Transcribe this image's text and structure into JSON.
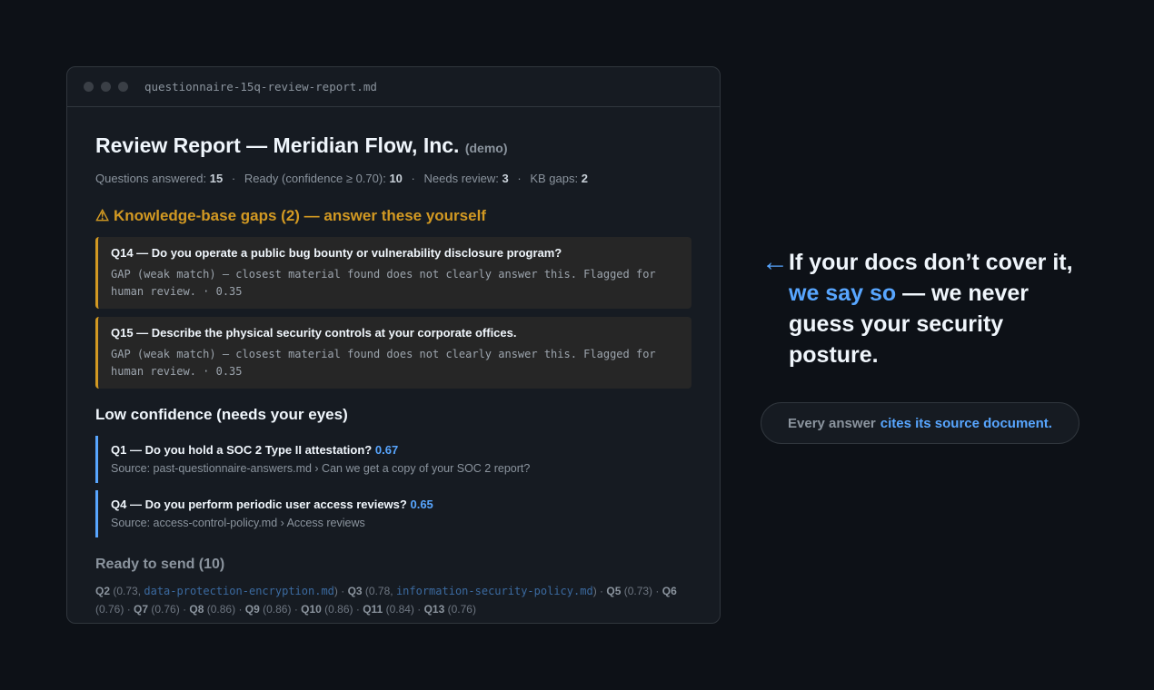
{
  "window": {
    "filename": "questionnaire-15q-review-report.md"
  },
  "report": {
    "title": "Review Report — Meridian Flow, Inc.",
    "demo_tag": "(demo)",
    "stats": {
      "answered_label": "Questions answered:",
      "answered_value": "15",
      "ready_label": "Ready (confidence ≥ 0.70):",
      "ready_value": "10",
      "review_label": "Needs review:",
      "review_value": "3",
      "gaps_label": "KB gaps:",
      "gaps_value": "2",
      "separator": "·"
    },
    "gaps_heading": "⚠ Knowledge-base gaps (2) — answer these yourself",
    "gaps": [
      {
        "question": "Q14 — Do you operate a public bug bounty or vulnerability disclosure program?",
        "note": "GAP (weak match) — closest material found does not clearly answer this. Flagged for human review. · 0.35"
      },
      {
        "question": "Q15 — Describe the physical security controls at your corporate offices.",
        "note": "GAP (weak match) — closest material found does not clearly answer this. Flagged for human review. · 0.35"
      }
    ],
    "low_heading": "Low confidence (needs your eyes)",
    "low": [
      {
        "question": "Q1 — Do you hold a SOC 2 Type II attestation?",
        "confidence": "0.67",
        "source": "Source: past-questionnaire-answers.md › Can we get a copy of your SOC 2 report?"
      },
      {
        "question": "Q4 — Do you perform periodic user access reviews?",
        "confidence": "0.65",
        "source": "Source: access-control-policy.md › Access reviews"
      }
    ],
    "ready_heading": "Ready to send (10)",
    "ready": [
      {
        "q": "Q2",
        "detail": "(0.73, ",
        "file": "data-protection-encryption.md",
        "close": ")"
      },
      {
        "q": "Q3",
        "detail": "(0.78, ",
        "file": "information-security-policy.md",
        "close": ")"
      },
      {
        "q": "Q5",
        "detail": "(0.73)",
        "file": "",
        "close": ""
      },
      {
        "q": "Q6",
        "detail": "(0.76)",
        "file": "",
        "close": ""
      },
      {
        "q": "Q7",
        "detail": "(0.76)",
        "file": "",
        "close": ""
      },
      {
        "q": "Q8",
        "detail": "(0.86)",
        "file": "",
        "close": ""
      },
      {
        "q": "Q9",
        "detail": "(0.86)",
        "file": "",
        "close": ""
      },
      {
        "q": "Q10",
        "detail": "(0.86)",
        "file": "",
        "close": ""
      },
      {
        "q": "Q11",
        "detail": "(0.84)",
        "file": "",
        "close": ""
      },
      {
        "q": "Q13",
        "detail": "(0.76)",
        "file": "",
        "close": ""
      }
    ]
  },
  "callout": {
    "arrow_icon": "left-arrow-icon",
    "line1": "If your docs don’t cover it,",
    "accent": "we say so",
    "rest": " — we never guess your security posture."
  },
  "pill": {
    "prefix": "Every answer",
    "accent": "cites its source document."
  },
  "colors": {
    "background": "#0d1117",
    "panel": "#161b22",
    "warning": "#d29922",
    "accent": "#58a6ff"
  }
}
